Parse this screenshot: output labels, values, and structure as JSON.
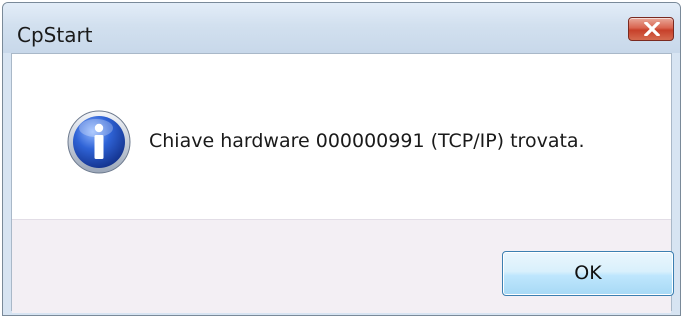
{
  "window": {
    "title": "CpStart",
    "close_icon": "close-icon"
  },
  "message": {
    "icon": "info-icon",
    "text": "Chiave hardware 000000991 (TCP/IP) trovata."
  },
  "buttons": {
    "ok_label": "OK"
  },
  "colors": {
    "close_button": "#d9644f",
    "ok_button_border": "#3c7fb1",
    "info_icon": "#1f4fb8"
  }
}
